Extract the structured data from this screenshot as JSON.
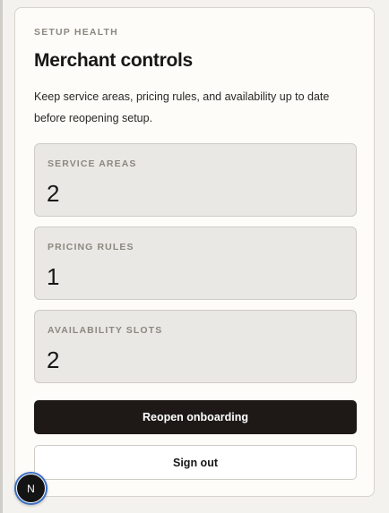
{
  "header": {
    "eyebrow": "SETUP HEALTH",
    "title": "Merchant controls",
    "description": "Keep service areas, pricing rules, and availability up to date before reopening setup."
  },
  "stats": [
    {
      "label": "SERVICE AREAS",
      "value": "2"
    },
    {
      "label": "PRICING RULES",
      "value": "1"
    },
    {
      "label": "AVAILABILITY SLOTS",
      "value": "2"
    }
  ],
  "actions": {
    "reopen_label": "Reopen onboarding",
    "signout_label": "Sign out"
  },
  "dev_badge": {
    "letter": "N"
  },
  "colors": {
    "primary_button": "#1e1917",
    "stat_background": "#e9e8e4",
    "badge_ring": "#3a6fc4"
  }
}
